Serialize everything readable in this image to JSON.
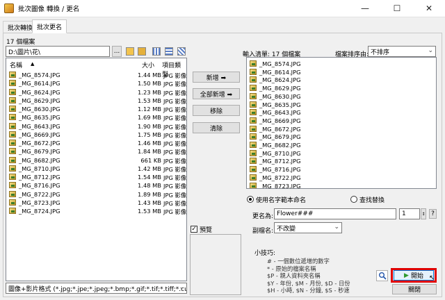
{
  "window": {
    "title": "批次圖像 轉換 / 更名"
  },
  "tabs": [
    {
      "label": "批次轉換"
    },
    {
      "label": "批次更名"
    }
  ],
  "left": {
    "file_count": "17 個檔案",
    "path": "D:\\圖片\\花\\",
    "columns": {
      "name": "名稱",
      "size": "大小",
      "type": "項目類型"
    },
    "files": [
      {
        "name": "_MG_8574.JPG",
        "size": "1.44 MB",
        "type": "JPG 影像"
      },
      {
        "name": "_MG_8614.JPG",
        "size": "1.50 MB",
        "type": "JPG 影像"
      },
      {
        "name": "_MG_8624.JPG",
        "size": "1.23 MB",
        "type": "JPG 影像"
      },
      {
        "name": "_MG_8629.JPG",
        "size": "1.53 MB",
        "type": "JPG 影像"
      },
      {
        "name": "_MG_8630.JPG",
        "size": "1.12 MB",
        "type": "JPG 影像"
      },
      {
        "name": "_MG_8635.JPG",
        "size": "1.69 MB",
        "type": "JPG 影像"
      },
      {
        "name": "_MG_8643.JPG",
        "size": "1.90 MB",
        "type": "JPG 影像"
      },
      {
        "name": "_MG_8669.JPG",
        "size": "1.75 MB",
        "type": "JPG 影像"
      },
      {
        "name": "_MG_8672.JPG",
        "size": "1.46 MB",
        "type": "JPG 影像"
      },
      {
        "name": "_MG_8679.JPG",
        "size": "1.84 MB",
        "type": "JPG 影像"
      },
      {
        "name": "_MG_8682.JPG",
        "size": "661 KB",
        "type": "JPG 影像"
      },
      {
        "name": "_MG_8710.JPG",
        "size": "1.42 MB",
        "type": "JPG 影像"
      },
      {
        "name": "_MG_8712.JPG",
        "size": "1.54 MB",
        "type": "JPG 影像"
      },
      {
        "name": "_MG_8716.JPG",
        "size": "1.48 MB",
        "type": "JPG 影像"
      },
      {
        "name": "_MG_8722.JPG",
        "size": "1.89 MB",
        "type": "JPG 影像"
      },
      {
        "name": "_MG_8723.JPG",
        "size": "1.43 MB",
        "type": "JPG 影像"
      },
      {
        "name": "_MG_8724.JPG",
        "size": "1.53 MB",
        "type": "JPG 影像"
      }
    ],
    "filter": "圖像+影片格式 (*.jpg;*.jpe;*.jpeg;*.bmp;*.gif;*.tif;*.tiff;*.cur;*.ic"
  },
  "middle": {
    "add": "新增 ➡",
    "add_all": "全部新增 ➡",
    "remove": "移除",
    "clear": "清除",
    "preview": "預覽"
  },
  "right": {
    "input_list": "輸入清單: 17 個檔案",
    "sort_label": "檔案排序由:",
    "sort_value": "不排序",
    "files": [
      "_MG_8574.JPG",
      "_MG_8614.JPG",
      "_MG_8624.JPG",
      "_MG_8629.JPG",
      "_MG_8630.JPG",
      "_MG_8635.JPG",
      "_MG_8643.JPG",
      "_MG_8669.JPG",
      "_MG_8672.JPG",
      "_MG_8679.JPG",
      "_MG_8682.JPG",
      "_MG_8710.JPG",
      "_MG_8712.JPG",
      "_MG_8716.JPG",
      "_MG_8722.JPG",
      "_MG_8723.JPG"
    ],
    "rename_mode": "使用名字範本命名",
    "replace_mode": "查找替換",
    "rename_label": "更名為:",
    "rename_value": "Flower###",
    "start_number": "1",
    "help": "?",
    "ext_label": "副檔名:",
    "ext_value": "不改變",
    "tips_title": "小技巧:",
    "tips": [
      "# - 一個數位遞增的數字",
      "* - 原始的檔案名稱",
      "$P - 親人資料夾名稱",
      "$Y - 年份,    $M - 月份,    $D - 日份",
      "$H - 小時,    $N - 分鐘,    $S - 秒速"
    ],
    "start": "開始",
    "close": "關閉"
  },
  "colors": {
    "accent": "#e00000",
    "start_icon": "#2e9a2e"
  }
}
